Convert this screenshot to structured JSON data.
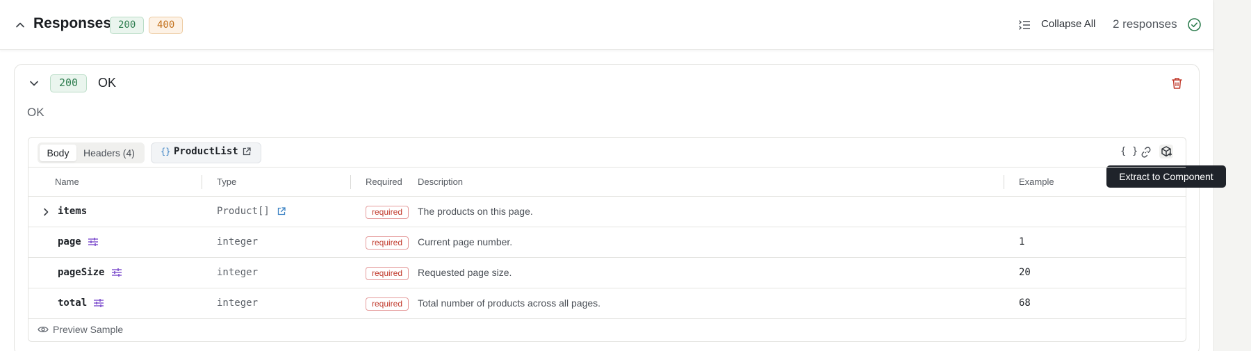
{
  "header": {
    "title": "Responses",
    "codes": [
      "200",
      "400"
    ],
    "collapse_all": "Collapse All",
    "count": "2 responses"
  },
  "response": {
    "code": "200",
    "label": "OK",
    "description": "OK",
    "tabs": {
      "body": "Body",
      "headers": "Headers (4)"
    },
    "schema": {
      "braces": "{}",
      "name": "ProductList"
    },
    "toolbar": {
      "braces": "{ }",
      "tooltip": "Extract to Component"
    },
    "columns": {
      "name": "Name",
      "type": "Type",
      "required": "Required",
      "description": "Description",
      "example": "Example"
    },
    "rows": [
      {
        "name": "items",
        "type": "Product[]",
        "required": "required",
        "description": "The products on this page.",
        "example": ""
      },
      {
        "name": "page",
        "type": "integer",
        "required": "required",
        "description": "Current page number.",
        "example": "1"
      },
      {
        "name": "pageSize",
        "type": "integer",
        "required": "required",
        "description": "Requested page size.",
        "example": "20"
      },
      {
        "name": "total",
        "type": "integer",
        "required": "required",
        "description": "Total number of products across all pages.",
        "example": "68"
      }
    ],
    "preview": "Preview Sample"
  },
  "colors": {
    "accent": "#3b82c4",
    "success": "#2e7d4f",
    "warning": "#c2701b",
    "danger": "#c0392b",
    "purple": "#7c4dcc"
  }
}
